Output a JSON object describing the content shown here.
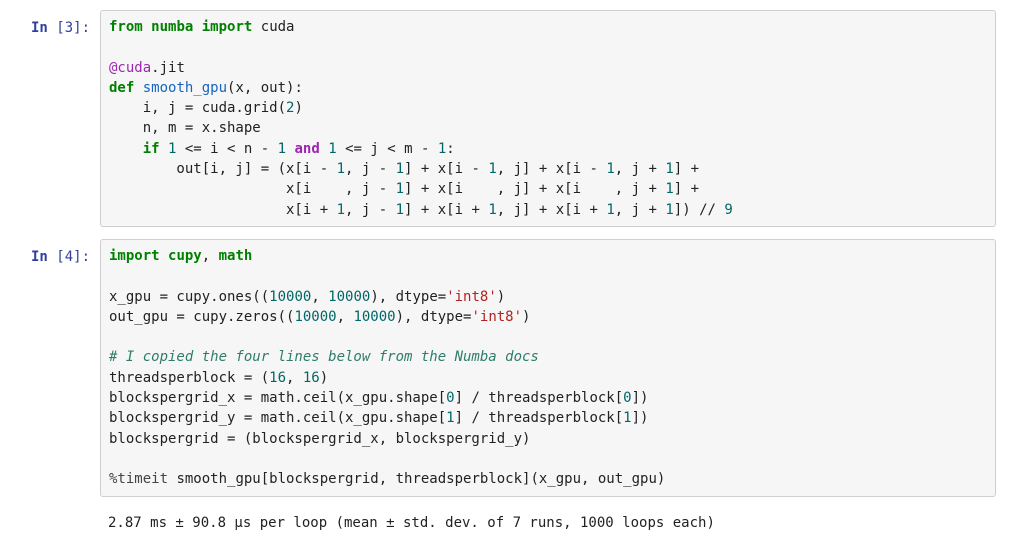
{
  "cells": [
    {
      "prompt_label": "In ",
      "prompt_num": "3",
      "tokens": [
        [
          "k",
          "from"
        ],
        [
          "p",
          " "
        ],
        [
          "nn",
          "numba"
        ],
        [
          "p",
          " "
        ],
        [
          "k",
          "import"
        ],
        [
          "p",
          " "
        ],
        [
          "p",
          "cuda\n"
        ],
        [
          "p",
          "\n"
        ],
        [
          "dec",
          "@cuda"
        ],
        [
          "p",
          ".jit\n"
        ],
        [
          "k",
          "def"
        ],
        [
          "p",
          " "
        ],
        [
          "fn",
          "smooth_gpu"
        ],
        [
          "p",
          "(x, out):\n"
        ],
        [
          "p",
          "    i, j = cuda.grid("
        ],
        [
          "num",
          "2"
        ],
        [
          "p",
          ")\n"
        ],
        [
          "p",
          "    n, m = x.shape\n"
        ],
        [
          "p",
          "    "
        ],
        [
          "k",
          "if"
        ],
        [
          "p",
          " "
        ],
        [
          "num",
          "1"
        ],
        [
          "p",
          " <= i < n - "
        ],
        [
          "num",
          "1"
        ],
        [
          "p",
          " "
        ],
        [
          "op",
          "and"
        ],
        [
          "p",
          " "
        ],
        [
          "num",
          "1"
        ],
        [
          "p",
          " <= j < m - "
        ],
        [
          "num",
          "1"
        ],
        [
          "p",
          ":\n"
        ],
        [
          "p",
          "        out[i, j] = (x[i - "
        ],
        [
          "num",
          "1"
        ],
        [
          "p",
          ", j - "
        ],
        [
          "num",
          "1"
        ],
        [
          "p",
          "] + x[i - "
        ],
        [
          "num",
          "1"
        ],
        [
          "p",
          ", j] + x[i - "
        ],
        [
          "num",
          "1"
        ],
        [
          "p",
          ", j + "
        ],
        [
          "num",
          "1"
        ],
        [
          "p",
          "] +\n"
        ],
        [
          "p",
          "                     x[i    , j - "
        ],
        [
          "num",
          "1"
        ],
        [
          "p",
          "] + x[i    , j] + x[i    , j + "
        ],
        [
          "num",
          "1"
        ],
        [
          "p",
          "] +\n"
        ],
        [
          "p",
          "                     x[i + "
        ],
        [
          "num",
          "1"
        ],
        [
          "p",
          ", j - "
        ],
        [
          "num",
          "1"
        ],
        [
          "p",
          "] + x[i + "
        ],
        [
          "num",
          "1"
        ],
        [
          "p",
          ", j] + x[i + "
        ],
        [
          "num",
          "1"
        ],
        [
          "p",
          ", j + "
        ],
        [
          "num",
          "1"
        ],
        [
          "p",
          "]) // "
        ],
        [
          "num",
          "9"
        ]
      ]
    },
    {
      "prompt_label": "In ",
      "prompt_num": "4",
      "tokens": [
        [
          "k",
          "import"
        ],
        [
          "p",
          " "
        ],
        [
          "nn",
          "cupy"
        ],
        [
          "p",
          ", "
        ],
        [
          "nn",
          "math"
        ],
        [
          "p",
          "\n"
        ],
        [
          "p",
          "\n"
        ],
        [
          "p",
          "x_gpu = cupy.ones(("
        ],
        [
          "num",
          "10000"
        ],
        [
          "p",
          ", "
        ],
        [
          "num",
          "10000"
        ],
        [
          "p",
          "), dtype="
        ],
        [
          "str",
          "'int8'"
        ],
        [
          "p",
          ")\n"
        ],
        [
          "p",
          "out_gpu = cupy.zeros(("
        ],
        [
          "num",
          "10000"
        ],
        [
          "p",
          ", "
        ],
        [
          "num",
          "10000"
        ],
        [
          "p",
          "), dtype="
        ],
        [
          "str",
          "'int8'"
        ],
        [
          "p",
          ")\n"
        ],
        [
          "p",
          "\n"
        ],
        [
          "cm",
          "# I copied the four lines below from the Numba docs"
        ],
        [
          "p",
          "\n"
        ],
        [
          "p",
          "threadsperblock = ("
        ],
        [
          "num",
          "16"
        ],
        [
          "p",
          ", "
        ],
        [
          "num",
          "16"
        ],
        [
          "p",
          ")\n"
        ],
        [
          "p",
          "blockspergrid_x = math.ceil(x_gpu.shape["
        ],
        [
          "num",
          "0"
        ],
        [
          "p",
          "] / threadsperblock["
        ],
        [
          "num",
          "0"
        ],
        [
          "p",
          "])\n"
        ],
        [
          "p",
          "blockspergrid_y = math.ceil(x_gpu.shape["
        ],
        [
          "num",
          "1"
        ],
        [
          "p",
          "] / threadsperblock["
        ],
        [
          "num",
          "1"
        ],
        [
          "p",
          "])\n"
        ],
        [
          "p",
          "blockspergrid = (blockspergrid_x, blockspergrid_y)\n"
        ],
        [
          "p",
          "\n"
        ],
        [
          "mag",
          "%timeit"
        ],
        [
          "p",
          " smooth_gpu[blockspergrid, threadsperblock](x_gpu, out_gpu)"
        ]
      ]
    }
  ],
  "output": "2.87 ms ± 90.8 µs per loop (mean ± std. dev. of 7 runs, 1000 loops each)"
}
